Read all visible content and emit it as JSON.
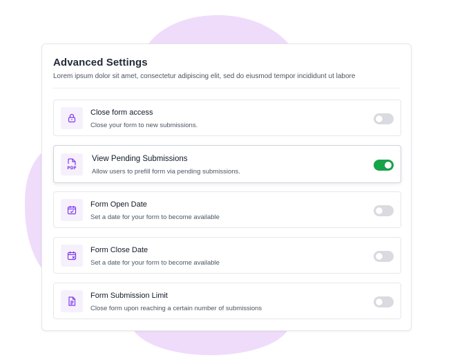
{
  "header": {
    "title": "Advanced Settings",
    "subtitle": "Lorem ipsum dolor sit amet, consectetur adipiscing elit, sed do eiusmod tempor incididunt ut labore"
  },
  "settings": [
    {
      "icon": "lock-icon",
      "title": "Close form access",
      "description": "Close your form to new submissions.",
      "enabled": false
    },
    {
      "icon": "pdf-file-icon",
      "title": "View Pending Submissions",
      "description": "Allow users to prefill form via pending submissions.",
      "enabled": true
    },
    {
      "icon": "calendar-check-icon",
      "title": "Form Open Date",
      "description": "Set a date for your form to become available",
      "enabled": false
    },
    {
      "icon": "calendar-x-icon",
      "title": "Form Close Date",
      "description": "Set a date for your form to become available",
      "enabled": false
    },
    {
      "icon": "document-list-icon",
      "title": "Form Submission Limit",
      "description": "Close form upon reaching a certain number of submissions",
      "enabled": false
    }
  ],
  "icon_text": {
    "pdf": "PDF"
  },
  "colors": {
    "accent": "#7c3aed",
    "toggle_on": "#16a34a",
    "toggle_off": "#d9dbe0",
    "icon_bg": "#f6f0fc",
    "blob": "#efdcfb"
  }
}
